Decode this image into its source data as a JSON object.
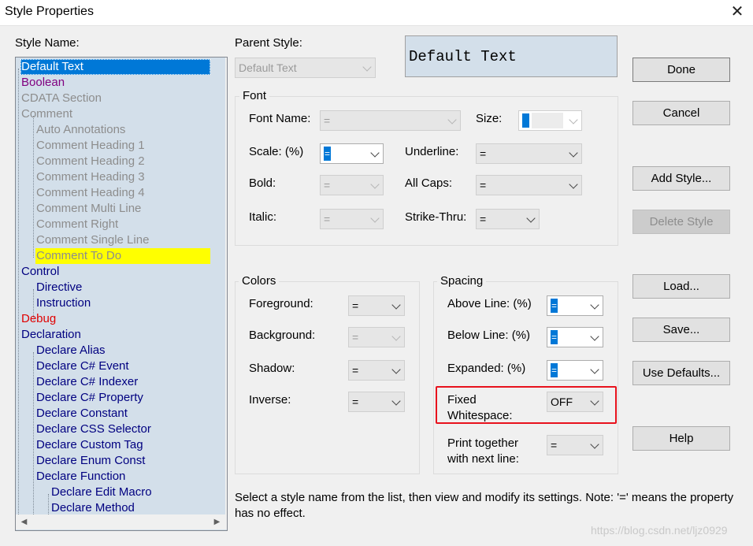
{
  "window": {
    "title": "Style Properties",
    "close_glyph": "✕"
  },
  "style_name": {
    "label": "Style Name:",
    "items": [
      {
        "text": "Default Text",
        "color": "#ffffff",
        "selected": true
      },
      {
        "text": "Boolean",
        "color": "#800080"
      },
      {
        "text": "CDATA Section",
        "color": "#8d8d8d"
      },
      {
        "text": "Comment",
        "color": "#8d8d8d"
      },
      {
        "text": "Auto Annotations",
        "color": "#8d8d8d"
      },
      {
        "text": "Comment Heading 1",
        "color": "#8d8d8d"
      },
      {
        "text": "Comment Heading 2",
        "color": "#8d8d8d"
      },
      {
        "text": "Comment Heading 3",
        "color": "#8d8d8d"
      },
      {
        "text": "Comment Heading 4",
        "color": "#8d8d8d"
      },
      {
        "text": "Comment Multi Line",
        "color": "#8d8d8d"
      },
      {
        "text": "Comment Right",
        "color": "#8d8d8d"
      },
      {
        "text": "Comment Single Line",
        "color": "#8d8d8d"
      },
      {
        "text": "Comment To Do",
        "color": "#8d8d8d",
        "highlight": "#ffff00"
      },
      {
        "text": "Control",
        "color": "#000080"
      },
      {
        "text": "Directive",
        "color": "#000080"
      },
      {
        "text": "Instruction",
        "color": "#000080"
      },
      {
        "text": "Debug",
        "color": "#e00000"
      },
      {
        "text": "Declaration",
        "color": "#000080"
      },
      {
        "text": "Declare Alias",
        "color": "#000080"
      },
      {
        "text": "Declare C# Event",
        "color": "#000080"
      },
      {
        "text": "Declare C# Indexer",
        "color": "#000080"
      },
      {
        "text": "Declare C# Property",
        "color": "#000080"
      },
      {
        "text": "Declare Constant",
        "color": "#000080"
      },
      {
        "text": "Declare CSS Selector",
        "color": "#000080"
      },
      {
        "text": "Declare Custom Tag",
        "color": "#000080"
      },
      {
        "text": "Declare Enum Const",
        "color": "#000080"
      },
      {
        "text": "Declare Function",
        "color": "#000080"
      },
      {
        "text": "Declare Edit Macro",
        "color": "#000080"
      },
      {
        "text": "Declare Method",
        "color": "#000080"
      }
    ]
  },
  "parent_style": {
    "label": "Parent Style:",
    "value": "Default Text"
  },
  "preview": {
    "text": "Default Text"
  },
  "font": {
    "group_label": "Font",
    "font_name": {
      "label": "Font Name:",
      "value": "="
    },
    "size": {
      "label": "Size:",
      "value": ""
    },
    "scale": {
      "label": "Scale: (%)",
      "value": "="
    },
    "underline": {
      "label": "Underline:",
      "value": "="
    },
    "bold": {
      "label": "Bold:",
      "value": "="
    },
    "all_caps": {
      "label": "All Caps:",
      "value": "="
    },
    "italic": {
      "label": "Italic:",
      "value": "="
    },
    "strike_thru": {
      "label": "Strike-Thru:",
      "value": "="
    }
  },
  "colors": {
    "group_label": "Colors",
    "foreground": {
      "label": "Foreground:",
      "value": "="
    },
    "background": {
      "label": "Background:",
      "value": "="
    },
    "shadow": {
      "label": "Shadow:",
      "value": "="
    },
    "inverse": {
      "label": "Inverse:",
      "value": "="
    }
  },
  "spacing": {
    "group_label": "Spacing",
    "above_line": {
      "label": "Above Line: (%)",
      "value": "="
    },
    "below_line": {
      "label": "Below Line: (%)",
      "value": "="
    },
    "expanded": {
      "label": "Expanded: (%)",
      "value": "="
    },
    "fixed_whitespace": {
      "label_line1": "Fixed",
      "label_line2": "Whitespace:",
      "value": "OFF"
    },
    "print_together": {
      "label_line1": "Print together",
      "label_line2": "with next line:",
      "value": "="
    }
  },
  "buttons": {
    "done": "Done",
    "cancel": "Cancel",
    "add_style": "Add Style...",
    "delete_style": "Delete Style",
    "load": "Load...",
    "save": "Save...",
    "use_defaults": "Use Defaults...",
    "help": "Help"
  },
  "note": "Select a style name from the list, then view and modify its settings. Note: '=' means the property has no effect.",
  "watermark": "https://blog.csdn.net/ljz0929",
  "colors_ui": {
    "selection": "#0078d7",
    "list_background": "#d3dfea",
    "callout": "#e8121d"
  }
}
